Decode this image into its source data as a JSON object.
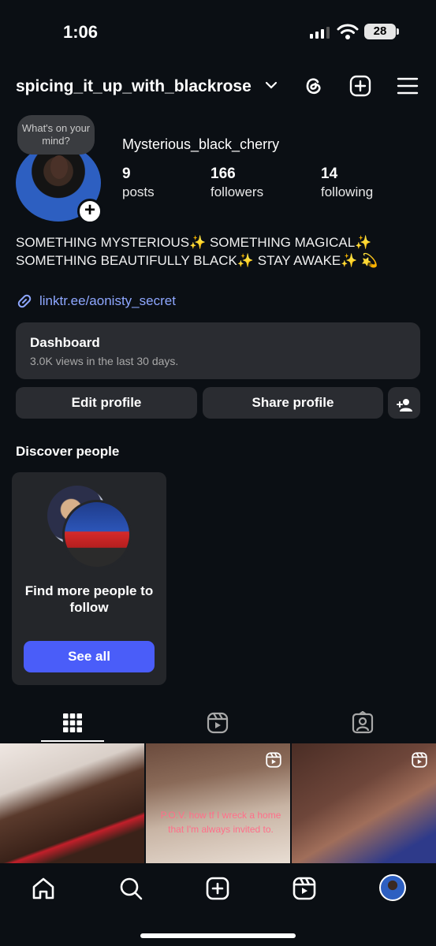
{
  "status": {
    "time": "1:06",
    "battery": "28"
  },
  "header": {
    "username": "spicing_it_up_with_blackrose"
  },
  "profile": {
    "note": "What's on your mind?",
    "display_name": "Mysterious_black_cherry",
    "stats": [
      {
        "num": "9",
        "label": "posts"
      },
      {
        "num": "166",
        "label": "followers"
      },
      {
        "num": "14",
        "label": "following"
      }
    ],
    "bio": "SOMETHING MYSTERIOUS✨ SOMETHING MAGICAL✨ SOMETHING BEAUTIFULLY BLACK✨ STAY AWAKE✨ 💫",
    "link": "linktr.ee/aonisty_secret"
  },
  "dashboard": {
    "title": "Dashboard",
    "subtitle": "3.0K views in the last 30 days."
  },
  "buttons": {
    "edit": "Edit profile",
    "share": "Share profile"
  },
  "discover": {
    "title": "Discover people",
    "card_title": "Find more people to follow",
    "see_all": "See all"
  },
  "grid": {
    "caption": "P.O.V. how tf I wreck a home that I'm always invited to."
  },
  "colors": {
    "accent": "#4a5df9",
    "link": "#8ea7ff",
    "background": "#0b0f14",
    "card": "#2a2c31"
  }
}
